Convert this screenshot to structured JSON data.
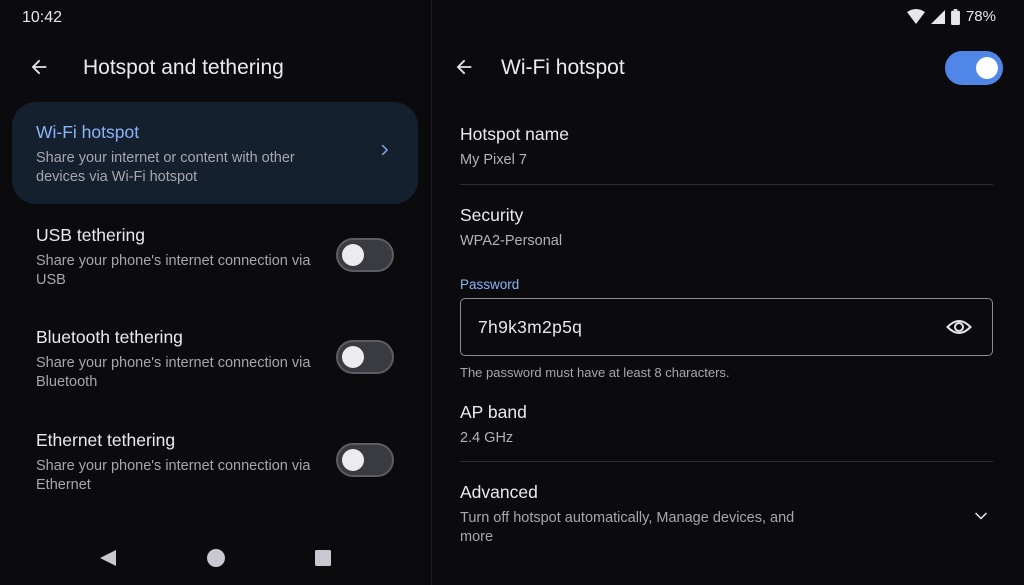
{
  "status_bar": {
    "time": "10:42",
    "battery": "78%",
    "icons": [
      "wifi-icon",
      "signal-icon",
      "battery-icon"
    ]
  },
  "left": {
    "title": "Hotspot and tethering",
    "items": [
      {
        "title": "Wi-Fi hotspot",
        "subtitle": "Share your internet or content with other devices via Wi-Fi hotspot",
        "selected": true,
        "control": "chevron-right-icon"
      },
      {
        "title": "USB tethering",
        "subtitle": "Share your phone's internet connection via USB",
        "toggle_on": false
      },
      {
        "title": "Bluetooth tethering",
        "subtitle": "Share your phone's internet connection via Bluetooth",
        "toggle_on": false
      },
      {
        "title": "Ethernet tethering",
        "subtitle": "Share your phone's internet connection via Ethernet",
        "toggle_on": false
      }
    ],
    "nav_icons": [
      "back-triangle-icon",
      "home-circle-icon",
      "recents-square-icon"
    ]
  },
  "right": {
    "title": "Wi-Fi hotspot",
    "master_toggle_on": true,
    "hotspot_name": {
      "label": "Hotspot name",
      "value": "My Pixel 7"
    },
    "security": {
      "label": "Security",
      "value": "WPA2-Personal"
    },
    "password": {
      "label": "Password",
      "value": "7h9k3m2p5q",
      "helper": "The password must have at least 8 characters."
    },
    "ap_band": {
      "label": "AP band",
      "value": "2.4 GHz"
    },
    "advanced": {
      "label": "Advanced",
      "summary": "Turn off hotspot automatically, Manage devices, and more"
    }
  },
  "colors": {
    "background": "#0b0b0d",
    "accent": "#8ab4f8",
    "toggle_on": "#4f86e8",
    "selected_item": "#15202e"
  }
}
